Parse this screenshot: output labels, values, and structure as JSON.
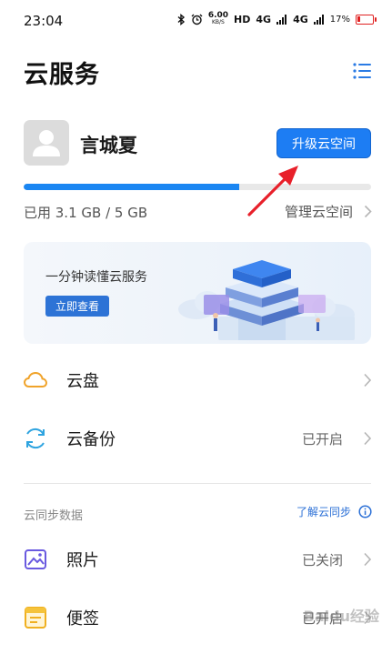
{
  "status_bar": {
    "time": "23:04",
    "speed_value": "6.00",
    "speed_unit": "KB/S",
    "hd": "HD",
    "signal_1": "4G",
    "signal_2": "4G",
    "battery": "17%"
  },
  "header": {
    "title": "云服务"
  },
  "account": {
    "username": "言城夏",
    "upgrade_label": "升级云空间",
    "storage_text": "已用 3.1 GB / 5 GB",
    "storage_used_fraction": 0.62,
    "manage_label": "管理云空间"
  },
  "banner": {
    "title": "一分钟读懂云服务",
    "button_label": "立即查看"
  },
  "items": [
    {
      "label": "云盘",
      "status": ""
    },
    {
      "label": "云备份",
      "status": "已开启"
    }
  ],
  "sync": {
    "section_title": "云同步数据",
    "learn_label": "了解云同步",
    "items": [
      {
        "label": "照片",
        "status": "已关闭"
      },
      {
        "label": "便签",
        "status": "已开启"
      }
    ]
  },
  "watermark": "Baidu经验",
  "colors": {
    "accent": "#1d7df3",
    "annotation_arrow": "#e8202a"
  }
}
